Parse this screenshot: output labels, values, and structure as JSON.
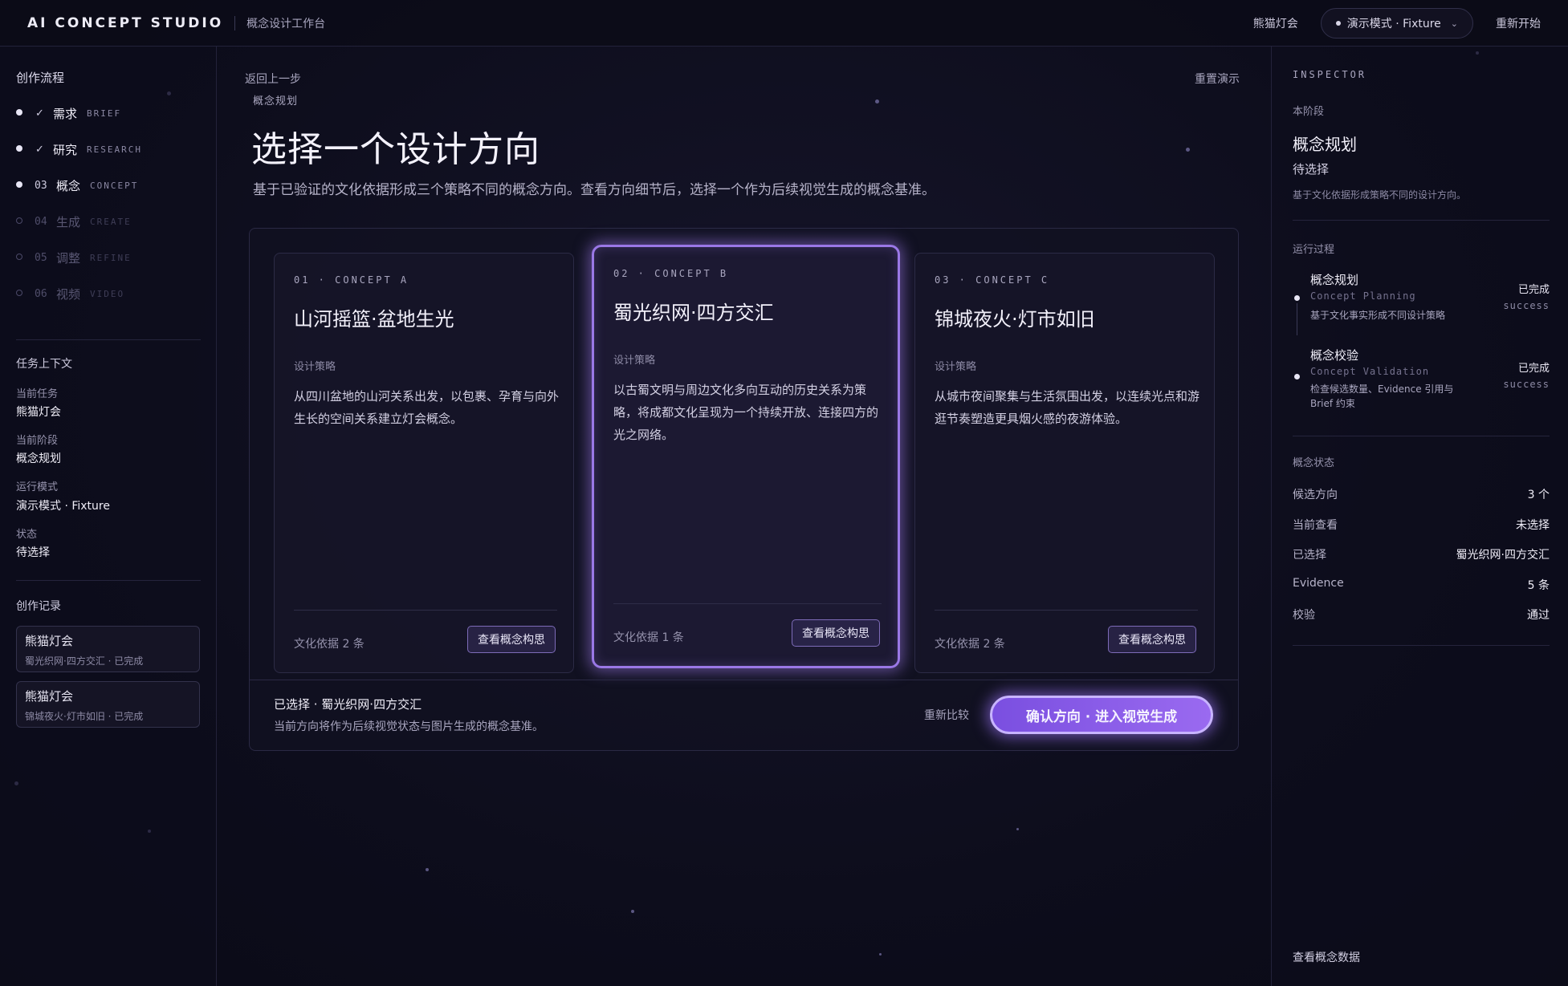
{
  "header": {
    "brand": "AI CONCEPT STUDIO",
    "subtitle": "概念设计工作台",
    "project_link": "熊猫灯会",
    "mode": "演示模式 · Fixture",
    "restart": "重新开始"
  },
  "sidebar": {
    "title": "创作流程",
    "steps": [
      {
        "mark": "✓",
        "zh": "需求",
        "en": "BRIEF",
        "state": "done"
      },
      {
        "mark": "✓",
        "zh": "研究",
        "en": "RESEARCH",
        "state": "done"
      },
      {
        "mark": "03",
        "zh": "概念",
        "en": "CONCEPT",
        "state": "current"
      },
      {
        "mark": "04",
        "zh": "生成",
        "en": "CREATE",
        "state": "pending"
      },
      {
        "mark": "05",
        "zh": "调整",
        "en": "REFINE",
        "state": "pending"
      },
      {
        "mark": "06",
        "zh": "视频",
        "en": "VIDEO",
        "state": "pending"
      }
    ],
    "context": {
      "title": "任务上下文",
      "items": [
        {
          "label": "当前任务",
          "value": "熊猫灯会"
        },
        {
          "label": "当前阶段",
          "value": "概念规划"
        },
        {
          "label": "运行模式",
          "value": "演示模式 · Fixture"
        },
        {
          "label": "状态",
          "value": "待选择"
        }
      ]
    },
    "records": {
      "title": "创作记录",
      "items": [
        {
          "name": "熊猫灯会",
          "meta": "蜀光织网·四方交汇 · 已完成"
        },
        {
          "name": "熊猫灯会",
          "meta": "锦城夜火·灯市如旧 · 已完成"
        }
      ]
    }
  },
  "main": {
    "back": "返回上一步",
    "reset_demo": "重置演示",
    "eyebrow": "概念规划",
    "title": "选择一个设计方向",
    "description": "基于已验证的文化依据形成三个策略不同的概念方向。查看方向细节后，选择一个作为后续视觉生成的概念基准。",
    "cards": [
      {
        "number": "01 · CONCEPT A",
        "title": "山河摇篮·盆地生光",
        "label": "设计策略",
        "body": "从四川盆地的山河关系出发，以包裹、孕育与向外生长的空间关系建立灯会概念。",
        "evidence": "文化依据 2 条",
        "button": "查看概念构思",
        "selected": false
      },
      {
        "number": "02 · CONCEPT B",
        "title": "蜀光织网·四方交汇",
        "label": "设计策略",
        "body": "以古蜀文明与周边文化多向互动的历史关系为策略，将成都文化呈现为一个持续开放、连接四方的光之网络。",
        "evidence": "文化依据 1 条",
        "button": "查看概念构思",
        "selected": true
      },
      {
        "number": "03 · CONCEPT C",
        "title": "锦城夜火·灯市如旧",
        "label": "设计策略",
        "body": "从城市夜间聚集与生活氛围出发，以连续光点和游逛节奏塑造更具烟火感的夜游体验。",
        "evidence": "文化依据 2 条",
        "button": "查看概念构思",
        "selected": false
      }
    ],
    "selection": {
      "title": "已选择 · 蜀光织网·四方交汇",
      "description": "当前方向将作为后续视觉状态与图片生成的概念基准。",
      "recompare": "重新比较",
      "confirm": "确认方向 · 进入视觉生成"
    }
  },
  "inspector": {
    "heading": "INSPECTOR",
    "stage_label": "本阶段",
    "stage": "概念规划",
    "status": "待选择",
    "stage_desc": "基于文化依据形成策略不同的设计方向。",
    "process_label": "运行过程",
    "process": [
      {
        "name": "概念规划",
        "en": "Concept Planning",
        "desc": "基于文化事实形成不同设计策略",
        "status": "已完成",
        "code": "success"
      },
      {
        "name": "概念校验",
        "en": "Concept Validation",
        "desc": "检查候选数量、Evidence 引用与 Brief 约束",
        "status": "已完成",
        "code": "success"
      }
    ],
    "concept_state_label": "概念状态",
    "concept_state": [
      {
        "key": "候选方向",
        "value": "3 个"
      },
      {
        "key": "当前查看",
        "value": "未选择"
      },
      {
        "key": "已选择",
        "value": "蜀光织网·四方交汇"
      },
      {
        "key": "Evidence",
        "value": "5 条"
      },
      {
        "key": "校验",
        "value": "通过"
      }
    ],
    "footer_link": "查看概念数据"
  }
}
